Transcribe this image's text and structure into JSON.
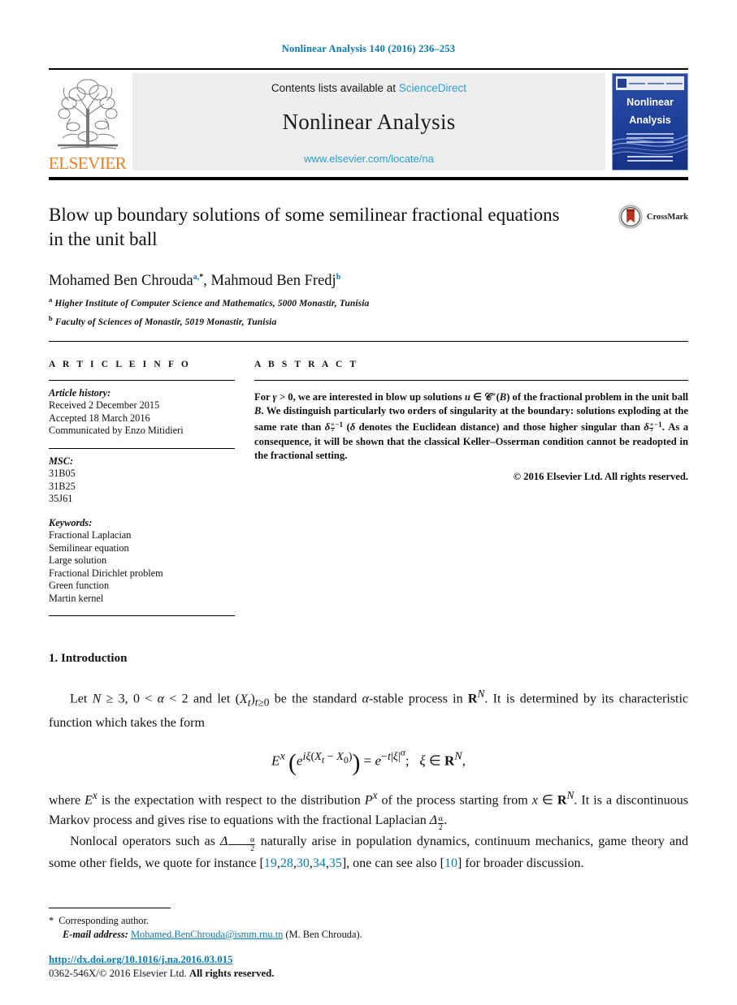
{
  "running_head": "Nonlinear Analysis 140 (2016) 236–253",
  "masthead": {
    "publisher_name": "ELSEVIER",
    "contents_prefix": "Contents lists available at",
    "contents_link": "ScienceDirect",
    "journal_name": "Nonlinear Analysis",
    "journal_url": "www.elsevier.com/locate/na",
    "cover_title_line1": "Nonlinear",
    "cover_title_line2": "Analysis"
  },
  "article": {
    "title": "Blow up boundary solutions of some semilinear fractional equations in the unit ball",
    "crossmark_label": "CrossMark",
    "authors_html": "Mohamed Ben Chrouda<sup>a,</sup><sup class=\"star\">*</sup>, Mahmoud Ben Fredj<sup>b</sup>",
    "affiliations": [
      {
        "marker": "a",
        "text": "Higher Institute of Computer Science and Mathematics, 5000 Monastir, Tunisia"
      },
      {
        "marker": "b",
        "text": "Faculty of Sciences of Monastir, 5019 Monastir, Tunisia"
      }
    ]
  },
  "info": {
    "heading": "A R T I C L E   I N F O",
    "history_label": "Article history:",
    "history_lines": [
      "Received 2 December 2015",
      "Accepted 18 March 2016",
      "Communicated by Enzo Mitidieri"
    ],
    "msc_label": "MSC:",
    "msc_codes": [
      "31B05",
      "31B25",
      "35J61"
    ],
    "keywords_label": "Keywords:",
    "keywords": [
      "Fractional Laplacian",
      "Semilinear equation",
      "Large solution",
      "Fractional Dirichlet problem",
      "Green function",
      "Martin kernel"
    ]
  },
  "abstract": {
    "heading": "A B S T R A C T",
    "text_html": "For <em class=\"mi\">γ</em> &gt; 0, we are interested in blow up solutions <em class=\"mi\">u</em> ∈ 𝒞<sup class=\"supnum\">+</sup>(<em class=\"mi\">B</em>) of the fractional problem in the unit ball <em class=\"mi\">B</em>. We distinguish particularly two orders of singularity at the boundary: solutions exploding at the same rate than <em class=\"mi\">δ</em><span class=\"supnum\"><span class=\"frac\"><span class=\"num\">α</span><span class=\"den\">2</span></span>−1</span> (<em class=\"mi\">δ</em> denotes the Euclidean distance) and those higher singular than <em class=\"mi\">δ</em><span class=\"supnum\"><span class=\"frac\"><span class=\"num\">α</span><span class=\"den\">2</span></span>−1</span>. As a consequence, it will be shown that the classical Keller–Osserman condition cannot be readopted in the fractional setting.",
    "copyright": "© 2016 Elsevier Ltd. All rights reserved."
  },
  "body": {
    "section_number_title": "1. Introduction",
    "para1_html": "Let <em class=\"mi\">N</em> ≥ 3, 0 &lt; <em class=\"mi\">α</em> &lt; 2 and let (<em class=\"mi\">X<sub>t</sub></em>)<sub><em class=\"mi\">t</em>≥0</sub> be the standard <em class=\"mi\">α</em>-stable process in <span class=\"bbR\">R</span><sup><em class=\"mi\">N</em></sup>. It is determined by its characteristic function which takes the form",
    "equation_html": "<em class=\"mi\">E</em><sup><em class=\"mi\">x</em></sup> <span class=\"bigparen\">(</span><em class=\"mi\">e</em><sup><em class=\"mi\">iξ</em>(<em class=\"mi\">X<sub>t</sub></em> − <em class=\"mi\">X</em><sub>0</sub>)</sup><span class=\"bigparen\">)</span> = <em class=\"mi\">e</em><sup>−<em class=\"mi\">t</em>|<em class=\"mi\">ξ</em>|<sup><em class=\"mi\">α</em></sup></sup>;&nbsp;&nbsp; <em class=\"mi\">ξ</em> ∈ <span class=\"bbR\">R</span><sup><em class=\"mi\">N</em></sup>,",
    "para2_html": "where <em class=\"mi\">E</em><sup><em class=\"mi\">x</em></sup> is the expectation with respect to the distribution <em class=\"mi\">P</em><sup><em class=\"mi\">x</em></sup> of the process starting from <em class=\"mi\">x</em> ∈ <span class=\"bbR\">R</span><sup><em class=\"mi\">N</em></sup>. It is a discontinuous Markov process and gives rise to equations with the fractional Laplacian <em class=\"mi\">Δ</em><span class=\"frac\"><span class=\"num\">α</span><span class=\"den\">2</span></span>.",
    "para3_html": "Nonlocal operators such as <em class=\"mi\">Δ</em><span class=\"frac\"><span class=\"num\">α</span><span class=\"den\">2</span></span> naturally arise in population dynamics, continuum mechanics, game theory and some other fields, we quote for instance [<span class=\"reflink\">19</span>,<span class=\"reflink\">28</span>,<span class=\"reflink\">30</span>,<span class=\"reflink\">34</span>,<span class=\"reflink\">35</span>], one can see also [<span class=\"reflink\">10</span>] for broader discussion."
  },
  "footnotes": {
    "corresponding_marker": "*",
    "corresponding_text": "Corresponding author.",
    "email_label": "E-mail address:",
    "email": "Mohamed.BenChrouda@ismm.rnu.tn",
    "email_owner": "(M. Ben Chrouda)."
  },
  "bottom": {
    "doi": "http://dx.doi.org/10.1016/j.na.2016.03.015",
    "issn_prefix": "0362-546X/",
    "issn_rest": "© 2016 Elsevier Ltd. ",
    "issn_bold": "All rights reserved."
  },
  "colors": {
    "link_blue": "#0b7ab5",
    "sciencedirect_blue": "#2a9fd6",
    "elsevier_orange": "#ef7d22",
    "cover_blue": "#2344a0",
    "crossmark_red": "#b8321f"
  }
}
